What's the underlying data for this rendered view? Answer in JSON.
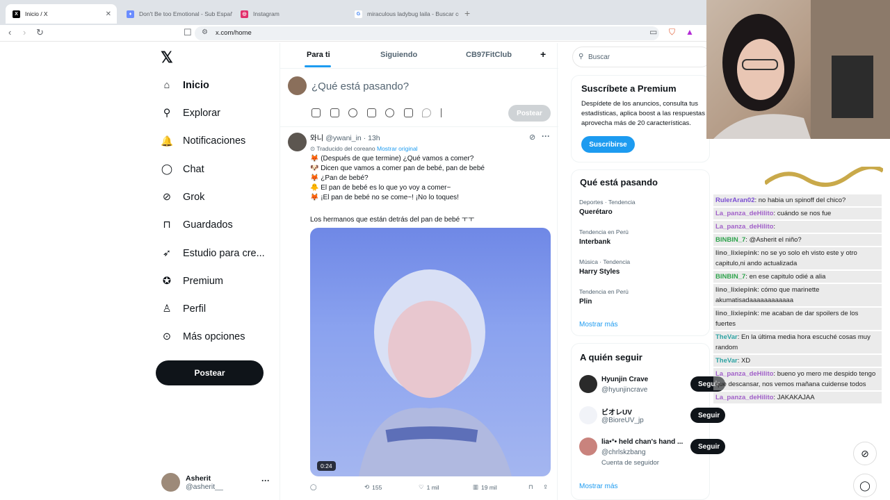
{
  "browser": {
    "tabs": [
      {
        "label": "Inicio / X",
        "favicon": "X",
        "fav_color": "#000000"
      },
      {
        "label": "Don't Be too Emotional - Sub Españo",
        "favicon": "♦",
        "fav_color": "#6a8cff"
      },
      {
        "label": "Instagram",
        "favicon": "◎",
        "fav_color": "#e1306c"
      },
      {
        "label": "miraculous ladybug laila - Buscar con",
        "favicon": "G",
        "fav_color": "#4285f4"
      }
    ],
    "url": "x.com/home"
  },
  "nav": {
    "items": [
      {
        "label": "Inicio",
        "icon": "home-icon",
        "glyph": "⌂"
      },
      {
        "label": "Explorar",
        "icon": "search-icon",
        "glyph": "⚲"
      },
      {
        "label": "Notificaciones",
        "icon": "bell-icon",
        "glyph": "🔔"
      },
      {
        "label": "Chat",
        "icon": "chat-icon",
        "glyph": "◯"
      },
      {
        "label": "Grok",
        "icon": "grok-icon",
        "glyph": "⊘"
      },
      {
        "label": "Guardados",
        "icon": "bookmark-icon",
        "glyph": "⊓"
      },
      {
        "label": "Estudio para cre...",
        "icon": "rocket-icon",
        "glyph": "➶"
      },
      {
        "label": "Premium",
        "icon": "premium-icon",
        "glyph": "✪"
      },
      {
        "label": "Perfil",
        "icon": "person-icon",
        "glyph": "♙"
      },
      {
        "label": "Más opciones",
        "icon": "more-circle-icon",
        "glyph": "⊙"
      }
    ],
    "post_label": "Postear",
    "account": {
      "name": "Asherit",
      "handle": "@asherit__"
    }
  },
  "feed": {
    "tabs": [
      "Para ti",
      "Siguiendo",
      "CB97FitClub"
    ],
    "compose_placeholder": "¿Qué está pasando?",
    "compose_post": "Postear",
    "tweet": {
      "author": "와니",
      "handle": "@ywani_in",
      "time": "· 13h",
      "translated": "Traducido del coreano",
      "show_original": "Mostrar original",
      "lines": [
        "🦊 (Después de que termine) ¿Qué vamos a comer?",
        "🐶 Dicen que vamos a comer pan de bebé, pan de bebé",
        "🦊 ¿Pan de bebé?",
        "🐥 El pan de bebé es lo que yo voy a comer~",
        "🦊 ¡El pan de bebé no se come~! ¡No lo toques!",
        "",
        "Los hermanos que están detrás del pan de bebé ㅜㅜ"
      ],
      "duration": "0:24",
      "retweets": "155",
      "likes": "1 mil",
      "views": "19 mil"
    }
  },
  "right": {
    "search_placeholder": "Buscar",
    "premium": {
      "title": "Suscríbete a Premium",
      "text": "Despídete de los anuncios, consulta tus estadísticas, aplica boost a las respuestas y aprovecha más de 20 características.",
      "button": "Suscribirse"
    },
    "trends_title": "Qué está pasando",
    "trends": [
      {
        "meta": "Deportes · Tendencia",
        "name": "Querétaro"
      },
      {
        "meta": "Tendencia en Perú",
        "name": "Interbank"
      },
      {
        "meta": "Música · Tendencia",
        "name": "Harry Styles"
      },
      {
        "meta": "Tendencia en Perú",
        "name": "Plin"
      }
    ],
    "show_more": "Mostrar más",
    "follow_title": "A quién seguir",
    "follow": [
      {
        "name": "Hyunjin Crave",
        "handle": "@hyunjincrave",
        "extra": ""
      },
      {
        "name": "ビオレUV",
        "handle": "@BioreUV_jp",
        "extra": ""
      },
      {
        "name": "lia•°• held chan's hand ...",
        "handle": "@chrlskzbang",
        "extra": "Cuenta de seguidor"
      }
    ],
    "follow_label": "Seguir",
    "follow_more": "Mostrar más"
  },
  "stream": {
    "chat": [
      {
        "user": "RulerAran02",
        "user_color": "#7b4ed1",
        "msg": ": no habia un spinoff del chico?"
      },
      {
        "user": "La_panza_deHilito",
        "user_color": "#a160c9",
        "msg": ": cuándo se nos fue"
      },
      {
        "user": "La_panza_deHilito",
        "user_color": "#a160c9",
        "msg": ":"
      },
      {
        "user": "BINBIN_7",
        "user_color": "#2ea34c",
        "msg": ": @Asherit el niño?"
      },
      {
        "user": "lino_lixiepink",
        "user_color": "#555555",
        "msg": ": no se yo solo eh visto este y otro capitulo,ni ando actualizada"
      },
      {
        "user": "BINBIN_7",
        "user_color": "#2ea34c",
        "msg": ": en ese capitulo odié a alia"
      },
      {
        "user": "lino_lixiepink",
        "user_color": "#555555",
        "msg": ": cómo que marinette akumatisadaaaaaaaaaaaa"
      },
      {
        "user": "lino_lixiepink",
        "user_color": "#555555",
        "msg": ": me acaban de dar spoilers de los fuertes"
      },
      {
        "user": "TheVar",
        "user_color": "#2ea3a3",
        "msg": ": En la última media hora escuché cosas muy random"
      },
      {
        "user": "TheVar",
        "user_color": "#2ea3a3",
        "msg": ": XD"
      },
      {
        "user": "La_panza_deHilito",
        "user_color": "#a160c9",
        "msg": ": bueno yo mero me despido tengo que descansar, nos vemos mañana cuidense todos"
      },
      {
        "user": "La_panza_deHilito",
        "user_color": "#a160c9",
        "msg": ": JAKAKAJAA"
      }
    ]
  }
}
